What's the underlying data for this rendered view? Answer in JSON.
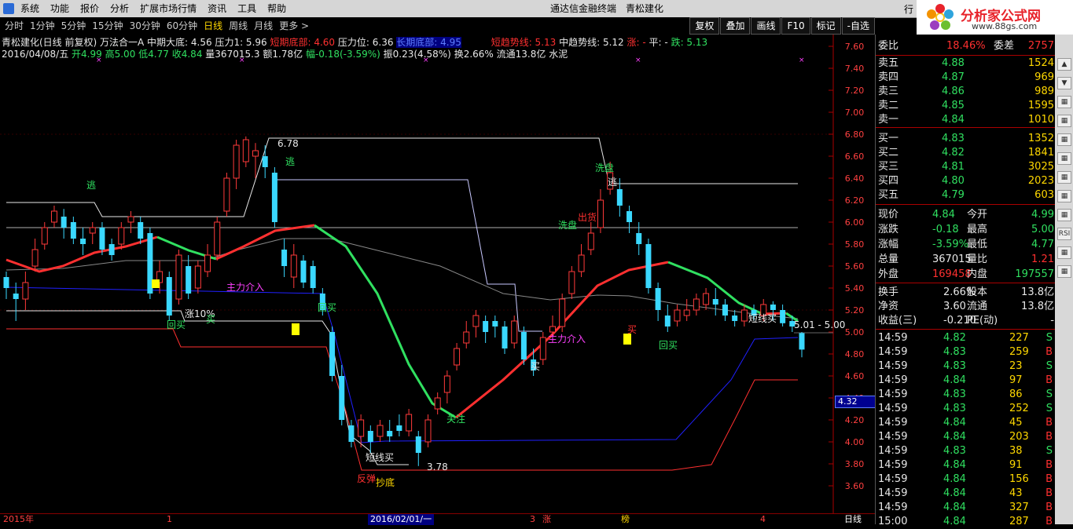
{
  "menu": [
    "系统",
    "功能",
    "报价",
    "分析",
    "扩展市场行情",
    "资讯",
    "工具",
    "帮助"
  ],
  "app_title": "通达信金融终端　青松建化",
  "brand": {
    "name": "分析家公式网",
    "url": "www.88gs.com"
  },
  "toolbar": {
    "periods": [
      "分时",
      "1分钟",
      "5分钟",
      "15分钟",
      "30分钟",
      "60分钟",
      "日线",
      "周线",
      "月线",
      "更多 >"
    ],
    "active_period": "日线",
    "right_buttons": [
      "复权",
      "叠加",
      "画线",
      "F10",
      "标记",
      "-自选"
    ]
  },
  "info1": {
    "name": "青松建化(日线 前复权) 万法合一A",
    "mid_bottom": "中期大底: 4.56",
    "pressure": "压力1: 5.96",
    "short_bottom": "短期底部: 4.60",
    "pressure_level": "压力位: 6.36",
    "long_bottom": "长期底部: 4.95",
    "short_trend": "短趋势线: 5.13",
    "mid_trend": "中趋势线: 5.12",
    "zhang": "涨: -",
    "ping": "平: -",
    "die": "跌: 5.13"
  },
  "info2": {
    "date": "2016/04/08/五",
    "open": "开4.99",
    "high": "高5.00",
    "low": "低4.77",
    "close": "收4.84",
    "vol": "量367015.3",
    "amount": "额1.78亿",
    "change": "幅-0.18(-3.59%)",
    "amp": "振0.23(4.58%)",
    "turnover": "换2.66%",
    "float": "流通13.8亿",
    "sector": "水泥"
  },
  "price_axis": [
    "7.60",
    "7.40",
    "7.20",
    "7.00",
    "6.80",
    "6.60",
    "6.40",
    "6.20",
    "6.00",
    "5.80",
    "5.60",
    "5.40",
    "5.20",
    "5.00",
    "4.80",
    "4.60",
    "4.40",
    "4.20",
    "4.00",
    "3.80",
    "3.60"
  ],
  "cursor_price": "4.32",
  "annotations": [
    {
      "text": "逃",
      "color": "#30e060"
    },
    {
      "text": "6.78",
      "color": "#e8e8e8"
    },
    {
      "text": "逃",
      "color": "#30e060"
    },
    {
      "text": "主力介入",
      "color": "#ff40ff"
    },
    {
      "text": "回买",
      "color": "#30e060"
    },
    {
      "text": "涨10%",
      "color": "#e8e8e8"
    },
    {
      "text": "买",
      "color": "#30e060"
    },
    {
      "text": "回买",
      "color": "#30e060"
    },
    {
      "text": "短线买",
      "color": "#e8e8e8"
    },
    {
      "text": "反弹",
      "color": "#ff3030"
    },
    {
      "text": "抄底",
      "color": "#ffd800"
    },
    {
      "text": "3.78",
      "color": "#e8e8e8"
    },
    {
      "text": "关注",
      "color": "#30e060"
    },
    {
      "text": "主力介入",
      "color": "#ff40ff"
    },
    {
      "text": "买",
      "color": "#e8e8e8"
    },
    {
      "text": "洗盘",
      "color": "#30e060"
    },
    {
      "text": "出货",
      "color": "#ff3030"
    },
    {
      "text": "洗盘",
      "color": "#30e060"
    },
    {
      "text": "逃",
      "color": "#e8e8e8"
    },
    {
      "text": "买",
      "color": "#ff3030"
    },
    {
      "text": "回买",
      "color": "#30e060"
    },
    {
      "text": "短线买",
      "color": "#e8e8e8"
    },
    {
      "text": "5.01 - 5.00",
      "color": "#e8e8e8"
    }
  ],
  "time_axis": [
    "2015年",
    "1",
    "2016/02/01/一",
    "3",
    "4"
  ],
  "bottom_labels": [
    "涨",
    "榜"
  ],
  "bottom_right": "日线",
  "quote": {
    "wei_bi": {
      "label": "委比",
      "value": "18.46%",
      "label2": "委差",
      "value2": "2757"
    },
    "sells": [
      {
        "label": "卖五",
        "price": "4.88",
        "vol": "1524"
      },
      {
        "label": "卖四",
        "price": "4.87",
        "vol": "969"
      },
      {
        "label": "卖三",
        "price": "4.86",
        "vol": "989"
      },
      {
        "label": "卖二",
        "price": "4.85",
        "vol": "1595"
      },
      {
        "label": "卖一",
        "price": "4.84",
        "vol": "1010"
      }
    ],
    "buys": [
      {
        "label": "买一",
        "price": "4.83",
        "vol": "1352"
      },
      {
        "label": "买二",
        "price": "4.82",
        "vol": "1841"
      },
      {
        "label": "买三",
        "price": "4.81",
        "vol": "3025"
      },
      {
        "label": "买四",
        "price": "4.80",
        "vol": "2023"
      },
      {
        "label": "买五",
        "price": "4.79",
        "vol": "603"
      }
    ],
    "stats": [
      {
        "l1": "现价",
        "v1": "4.84",
        "c1": "#30e060",
        "l2": "今开",
        "v2": "4.99",
        "c2": "#30e060"
      },
      {
        "l1": "涨跌",
        "v1": "-0.18",
        "c1": "#30e060",
        "l2": "最高",
        "v2": "5.00",
        "c2": "#30e060"
      },
      {
        "l1": "涨幅",
        "v1": "-3.59%",
        "c1": "#30e060",
        "l2": "最低",
        "v2": "4.77",
        "c2": "#30e060"
      },
      {
        "l1": "总量",
        "v1": "367015",
        "c1": "#e8e8e8",
        "l2": "量比",
        "v2": "1.21",
        "c2": "#ff3030"
      },
      {
        "l1": "外盘",
        "v1": "169458",
        "c1": "#ff3030",
        "l2": "内盘",
        "v2": "197557",
        "c2": "#30e060"
      }
    ],
    "stats2": [
      {
        "l1": "换手",
        "v1": "2.66%",
        "l2": "股本",
        "v2": "13.8亿"
      },
      {
        "l1": "净资",
        "v1": "3.60",
        "l2": "流通",
        "v2": "13.8亿"
      },
      {
        "l1": "收益(三)",
        "v1": "-0.210",
        "l2": "PE(动)",
        "v2": "-"
      }
    ],
    "ticks": [
      {
        "t": "14:59",
        "p": "4.82",
        "v": "227",
        "s": "S"
      },
      {
        "t": "14:59",
        "p": "4.83",
        "v": "259",
        "s": "B"
      },
      {
        "t": "14:59",
        "p": "4.83",
        "v": "23",
        "s": "S"
      },
      {
        "t": "14:59",
        "p": "4.84",
        "v": "97",
        "s": "B"
      },
      {
        "t": "14:59",
        "p": "4.83",
        "v": "86",
        "s": "S"
      },
      {
        "t": "14:59",
        "p": "4.83",
        "v": "252",
        "s": "S"
      },
      {
        "t": "14:59",
        "p": "4.84",
        "v": "45",
        "s": "B"
      },
      {
        "t": "14:59",
        "p": "4.84",
        "v": "203",
        "s": "B"
      },
      {
        "t": "14:59",
        "p": "4.83",
        "v": "38",
        "s": "S"
      },
      {
        "t": "14:59",
        "p": "4.84",
        "v": "91",
        "s": "B"
      },
      {
        "t": "14:59",
        "p": "4.84",
        "v": "156",
        "s": "B"
      },
      {
        "t": "14:59",
        "p": "4.84",
        "v": "43",
        "s": "B"
      },
      {
        "t": "14:59",
        "p": "4.84",
        "v": "327",
        "s": "B"
      },
      {
        "t": "15:00",
        "p": "4.84",
        "v": "287",
        "s": "B"
      }
    ]
  },
  "sidebar_icons": [
    "up-arrow",
    "down-arrow",
    "grid",
    "bar-chart",
    "line-chart",
    "candles",
    "table",
    "list",
    "grid",
    "RSI",
    "settings",
    "stack"
  ]
}
